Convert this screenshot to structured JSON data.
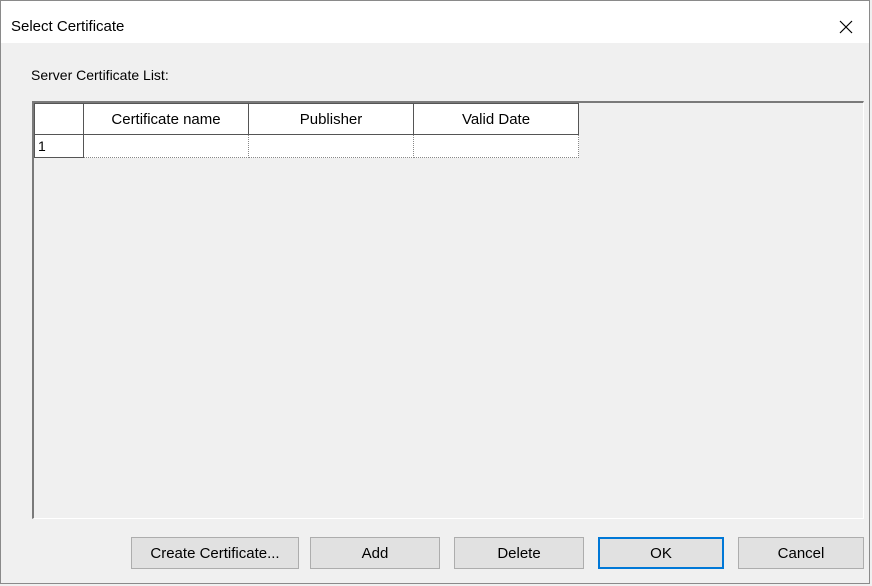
{
  "window": {
    "title": "Select Certificate"
  },
  "list": {
    "label": "Server Certificate List:",
    "columns": [
      "Certificate name",
      "Publisher",
      "Valid Date"
    ],
    "rows": [
      {
        "index": "1",
        "certificate_name": "",
        "publisher": "",
        "valid_date": ""
      }
    ]
  },
  "buttons": {
    "create": "Create Certificate...",
    "add": "Add",
    "delete": "Delete",
    "ok": "OK",
    "cancel": "Cancel"
  },
  "icons": {
    "close": "close-icon"
  },
  "colors": {
    "default_button_border": "#0078d7",
    "window_bg": "#f0f0f0"
  }
}
